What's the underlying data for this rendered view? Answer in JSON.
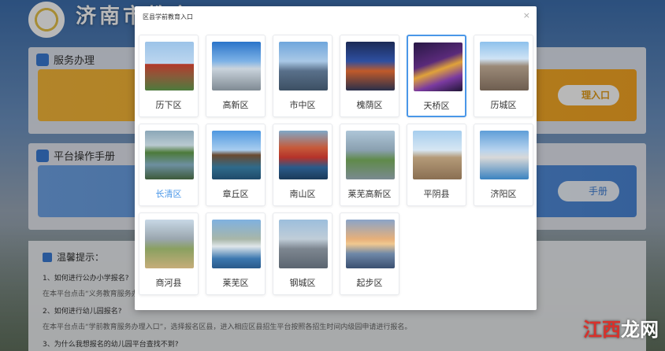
{
  "site": {
    "title": "济南市教育",
    "watermark_a": "江西",
    "watermark_b": "龙网"
  },
  "panels": {
    "service": {
      "title": "服务办理",
      "button": "理入口"
    },
    "manual": {
      "title": "平台操作手册",
      "button": "手册"
    }
  },
  "tips": {
    "title": "温馨提示：",
    "items": [
      {
        "q": "1、如何进行公办小学报名?",
        "a": "在本平台点击“义务教育服务办理入口”"
      },
      {
        "q": "2、如何进行幼儿园报名?",
        "a": "在本平台点击“学前教育服务办理入口”，选择报名区县，进入相应区县招生平台按照各招生时间内级园申请进行报名。"
      },
      {
        "q": "3、为什么我想报名的幼儿园平台查找不到?",
        "a": ""
      }
    ]
  },
  "modal": {
    "title": "区县学前教育入口",
    "close": "×",
    "districts": [
      {
        "name": "历下区",
        "icon": "landmark-gate-photo"
      },
      {
        "name": "高新区",
        "icon": "city-skyline-photo"
      },
      {
        "name": "市中区",
        "icon": "skyscraper-photo"
      },
      {
        "name": "槐荫区",
        "icon": "night-city-photo"
      },
      {
        "name": "天桥区",
        "icon": "bridge-night-photo"
      },
      {
        "name": "历城区",
        "icon": "cathedral-photo"
      },
      {
        "name": "长清区",
        "icon": "lake-photo"
      },
      {
        "name": "章丘区",
        "icon": "pavilion-lake-photo"
      },
      {
        "name": "南山区",
        "icon": "autumn-mountain-photo"
      },
      {
        "name": "莱芜高新区",
        "icon": "aerial-city-photo"
      },
      {
        "name": "平阴县",
        "icon": "church-photo"
      },
      {
        "name": "济阳区",
        "icon": "waterfront-photo"
      },
      {
        "name": "商河县",
        "icon": "building-park-photo"
      },
      {
        "name": "莱芜区",
        "icon": "mountain-town-photo"
      },
      {
        "name": "钢城区",
        "icon": "industrial-photo"
      },
      {
        "name": "起步区",
        "icon": "sunset-bridge-photo"
      }
    ],
    "selected": "天桥区",
    "highlighted_text": "长清区"
  },
  "colors": {
    "accent": "#4a97e8",
    "banner_yellow": "#f5a623",
    "banner_blue": "#4a86d6"
  }
}
